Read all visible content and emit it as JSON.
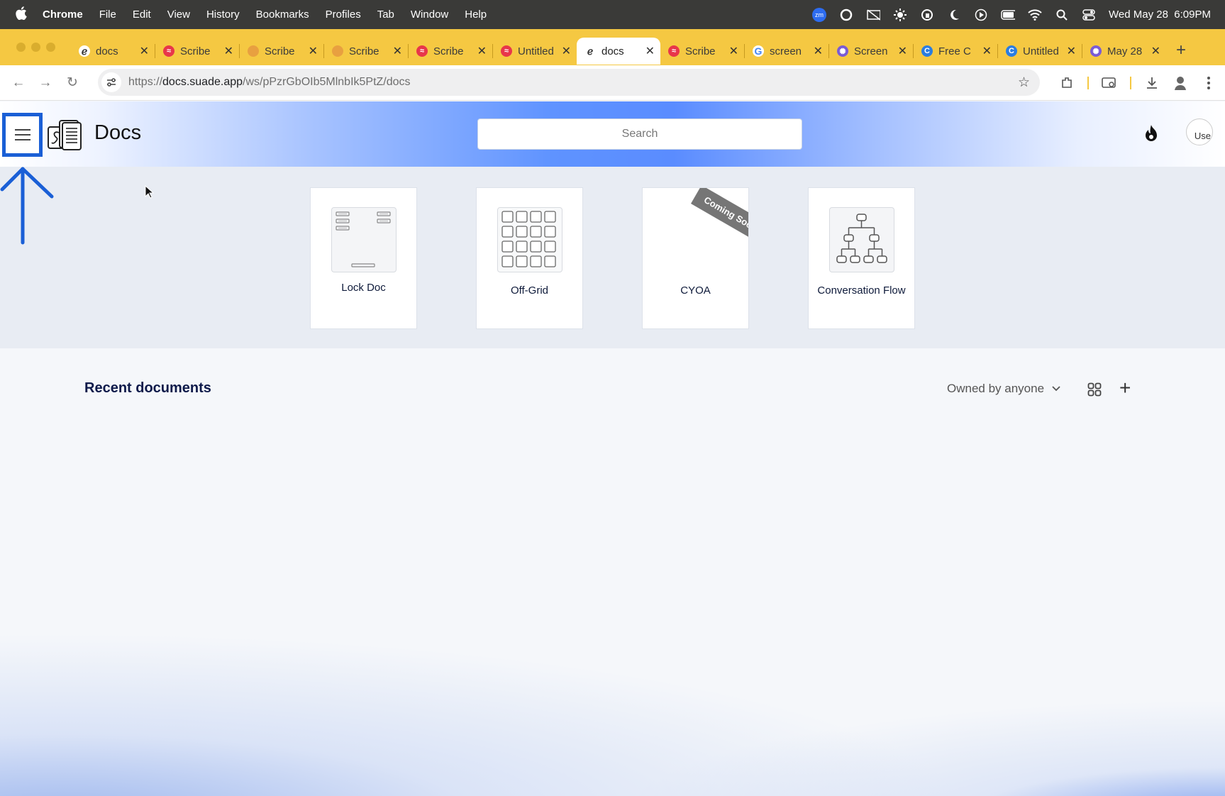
{
  "menubar": {
    "app_name": "Chrome",
    "items": [
      "File",
      "Edit",
      "View",
      "History",
      "Bookmarks",
      "Profiles",
      "Tab",
      "Window",
      "Help"
    ],
    "clock": "Wed May 28  6:09PM",
    "zoom_badge": "zm"
  },
  "tabs": [
    {
      "title": "docs",
      "favicon": "docs-favicon",
      "color": "#ffffff",
      "active": false
    },
    {
      "title": "Scribe",
      "favicon": "scribe-favicon",
      "color": "#e8364a",
      "active": false
    },
    {
      "title": "Scribe",
      "favicon": "rainbow-favicon",
      "color": "#e8a040",
      "active": false
    },
    {
      "title": "Scribe",
      "favicon": "rainbow-favicon",
      "color": "#e8a040",
      "active": false
    },
    {
      "title": "Scribe",
      "favicon": "scribe-favicon",
      "color": "#e8364a",
      "active": false
    },
    {
      "title": "Untitled",
      "favicon": "scribe-favicon",
      "color": "#e8364a",
      "active": false
    },
    {
      "title": "docs",
      "favicon": "docs-favicon",
      "color": "#ffffff",
      "active": true
    },
    {
      "title": "Scribe",
      "favicon": "scribe-favicon",
      "color": "#e8364a",
      "active": false
    },
    {
      "title": "screen",
      "favicon": "google-favicon",
      "color": "#ffffff",
      "active": false
    },
    {
      "title": "Screen",
      "favicon": "gear-favicon",
      "color": "#7a5bd6",
      "active": false
    },
    {
      "title": "Free C",
      "favicon": "c-favicon",
      "color": "#2a7de1",
      "active": false
    },
    {
      "title": "Untitled",
      "favicon": "c-favicon",
      "color": "#2a7de1",
      "active": false
    },
    {
      "title": "May 28",
      "favicon": "gear-favicon",
      "color": "#7a5bd6",
      "active": false
    }
  ],
  "address": {
    "scheme": "https://",
    "host": "docs.suade.app",
    "path": "/ws/pPzrGbOIb5MlnbIk5PtZ/docs"
  },
  "header": {
    "title": "Docs",
    "search_placeholder": "Search",
    "avatar_alt": "Use"
  },
  "templates": [
    {
      "label": "Lock Doc",
      "icon": "lock-doc-icon"
    },
    {
      "label": "Off-Grid",
      "icon": "grid-icon"
    },
    {
      "label": "CYOA",
      "icon": "none",
      "ribbon": "Coming Soon"
    },
    {
      "label": "Conversation Flow",
      "icon": "flowchart-icon"
    }
  ],
  "recent": {
    "title": "Recent documents",
    "owner_filter": "Owned by anyone"
  },
  "colors": {
    "accent": "#1a5fd6",
    "tabstrip": "#f5c842",
    "header_blue": "#5a8cff"
  }
}
